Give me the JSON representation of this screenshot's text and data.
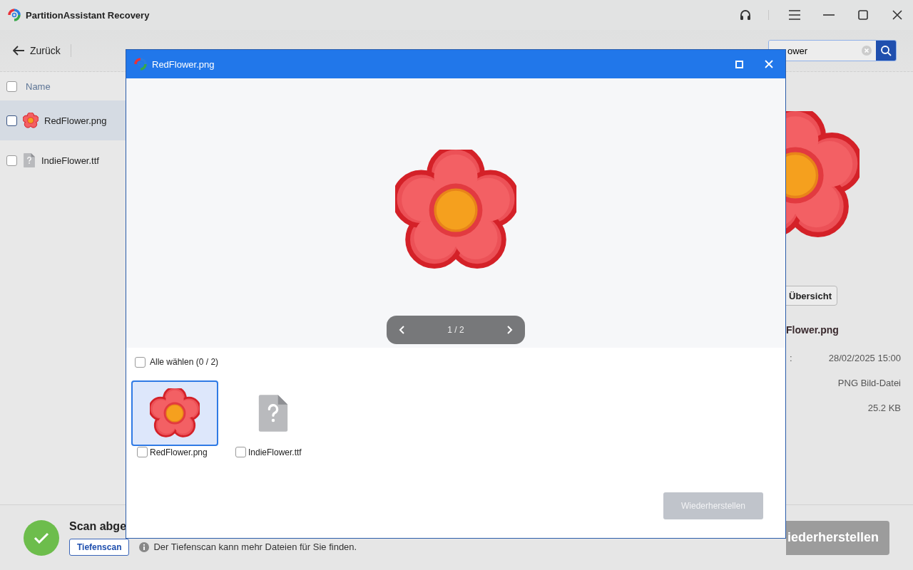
{
  "app": {
    "title": "PartitionAssistant Recovery"
  },
  "toolbar": {
    "back": "Zurück",
    "search": {
      "value": "ower"
    }
  },
  "file_list": {
    "header": {
      "label": "Name",
      "checked": false
    },
    "rows": [
      {
        "name": "RedFlower.png",
        "kind": "image",
        "checked": false,
        "selected": true
      },
      {
        "name": "IndieFlower.ttf",
        "kind": "unknown",
        "checked": false,
        "selected": false
      }
    ]
  },
  "details": {
    "overview_button": "Übersicht",
    "file_name": "Flower.png",
    "fields": [
      {
        "label": ":",
        "value": "28/02/2025 15:00"
      },
      {
        "value": "PNG Bild-Datei"
      },
      {
        "value": "25.2 KB"
      }
    ]
  },
  "status": {
    "title": "Scan abge",
    "deep_scan_button": "Tiefenscan",
    "hint": "Der Tiefenscan kann mehr Dateien für Sie finden.",
    "recover_button": {
      "label": "iederherstellen",
      "disabled": true
    }
  },
  "preview_dialog": {
    "title": "RedFlower.png",
    "pager": "1 / 2",
    "select_all": {
      "label": "Alle wählen (0 / 2)",
      "checked": false
    },
    "thumbnails": [
      {
        "name": "RedFlower.png",
        "kind": "image",
        "checked": false,
        "selected": true
      },
      {
        "name": "IndieFlower.ttf",
        "kind": "unknown",
        "checked": false,
        "selected": false
      }
    ],
    "recover_button": {
      "label": "Wiederherstellen",
      "disabled": true
    }
  }
}
